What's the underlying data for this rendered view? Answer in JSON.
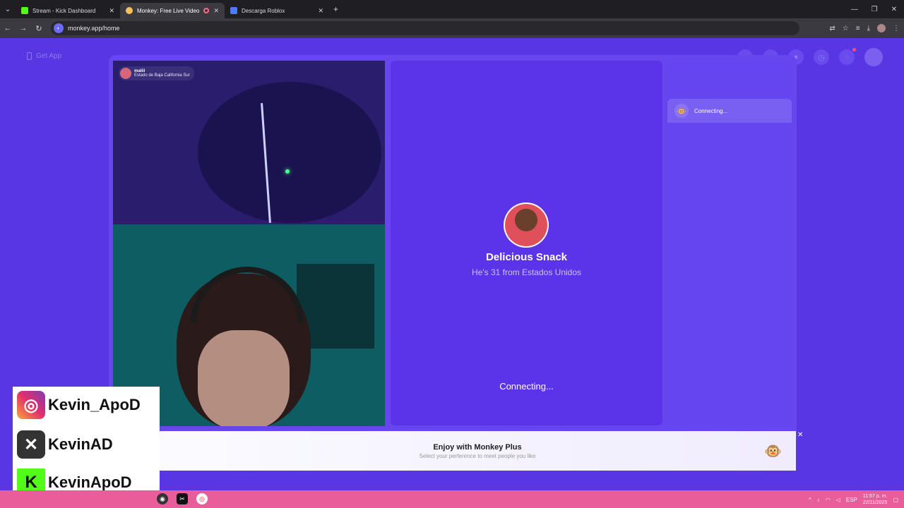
{
  "browser": {
    "tabs": [
      {
        "label": "Stream - Kick Dashboard",
        "fav_color": "#53fc18"
      },
      {
        "label": "Monkey: Free Live Video Ch",
        "fav_color": "#f5c15a",
        "active": true
      },
      {
        "label": "Descarga Roblox",
        "fav_color": "#4b7bff"
      }
    ],
    "url": "monkey.app/home"
  },
  "header": {
    "get_app": "Get App"
  },
  "local_cam": {
    "name": "maliii",
    "location": "Estado de Baja California Sur"
  },
  "match": {
    "name": "Delicious Snack",
    "info": "He's 31 from Estados Unidos",
    "status": "Connecting..."
  },
  "side": {
    "status": "Connecting..."
  },
  "promo": {
    "title": "Enjoy with Monkey Plus",
    "subtitle": "Select your perference to meet people you like"
  },
  "socials": {
    "instagram": "Kevin_ApoD",
    "x": "KevinAD",
    "kick": "KevinApoD"
  },
  "taskbar": {
    "lang": "ESP",
    "time": "11:57 p. m.",
    "date": "22/11/2025"
  },
  "colors": {
    "page": "#5936e4",
    "panel": "#6746ef",
    "accent": "#ffffff"
  }
}
